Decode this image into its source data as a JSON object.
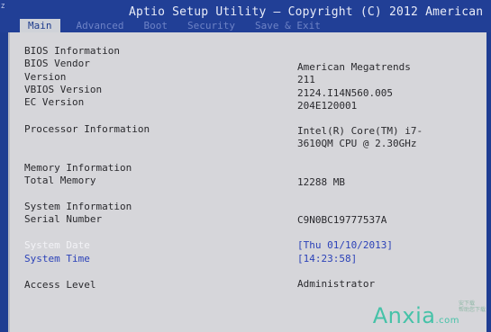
{
  "header": {
    "title": "Aptio Setup Utility – Copyright (C) 2012 American",
    "corner_mark": "Z"
  },
  "tabs": [
    {
      "label": "Main",
      "active": true
    },
    {
      "label": "Advanced",
      "active": false
    },
    {
      "label": "Boot",
      "active": false
    },
    {
      "label": "Security",
      "active": false
    },
    {
      "label": "Save & Exit",
      "active": false
    }
  ],
  "bios": {
    "section_title": "BIOS Information",
    "vendor_label": "BIOS Vendor",
    "vendor_value": "American Megatrends",
    "version_label": "Version",
    "version_value": "211",
    "vbios_label": "VBIOS Version",
    "vbios_value": "2124.I14N560.005",
    "ec_label": "EC Version",
    "ec_value": "204E120001"
  },
  "processor": {
    "label": "Processor Information",
    "value_line1": "Intel(R) Core(TM) i7-",
    "value_line2": "3610QM CPU @ 2.30GHz"
  },
  "memory": {
    "section_title": "Memory Information",
    "total_label": "Total Memory",
    "total_value": "12288 MB"
  },
  "system": {
    "section_title": "System Information",
    "serial_label": "Serial Number",
    "serial_value": "C9N0BC19777537A",
    "date_label": "System Date",
    "date_value": "[Thu 01/10/2013]",
    "time_label": "System Time",
    "time_value": "[14:23:58]"
  },
  "access": {
    "label": "Access Level",
    "value": "Administrator"
  },
  "watermark": {
    "text": "Anxia",
    "tld": ".com",
    "sub_line1": "安下载",
    "sub_line2": "帮助您下载"
  }
}
